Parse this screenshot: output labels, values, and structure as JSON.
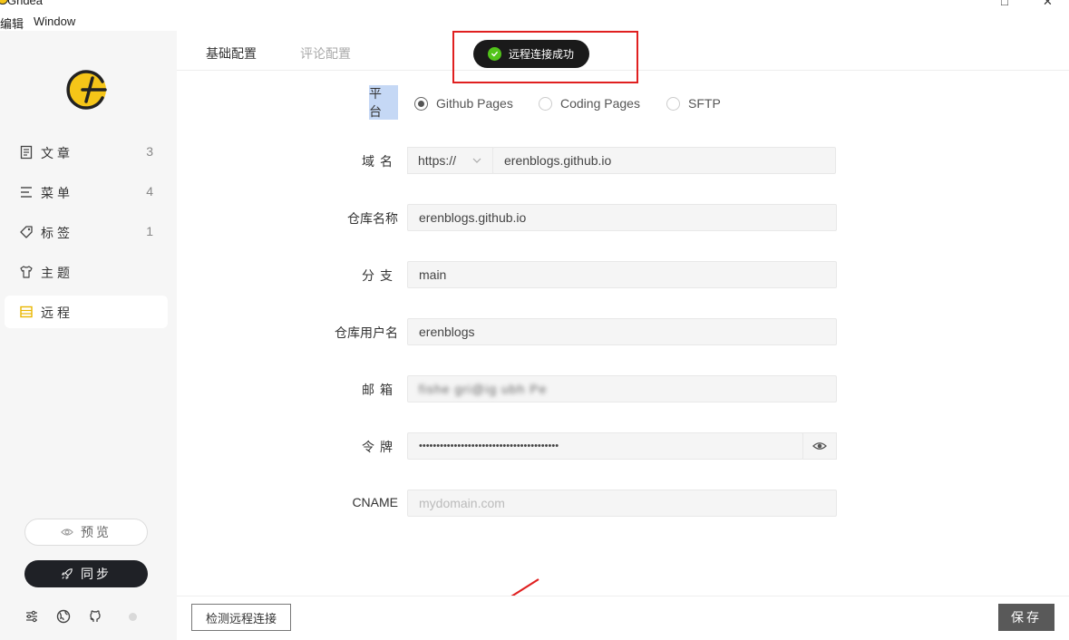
{
  "window": {
    "title": "Gridea",
    "menu": [
      "编辑",
      "Window"
    ],
    "controls": [
      "□",
      "✕"
    ]
  },
  "sidebar": {
    "logo": "gridea-logo",
    "items": [
      {
        "label": "文章",
        "count": "3",
        "icon": "article-icon",
        "active": false
      },
      {
        "label": "菜单",
        "count": "4",
        "icon": "menu-icon",
        "active": false
      },
      {
        "label": "标签",
        "count": "1",
        "icon": "tag-icon",
        "active": false
      },
      {
        "label": "主题",
        "count": "",
        "icon": "theme-icon",
        "active": false
      },
      {
        "label": "远程",
        "count": "",
        "icon": "remote-icon",
        "active": true
      }
    ],
    "preview_label": "预览",
    "sync_label": "同步",
    "footer_icons": [
      "settings-icon",
      "globe-icon",
      "github-icon"
    ]
  },
  "tabs": [
    {
      "label": "基础配置",
      "active": true
    },
    {
      "label": "评论配置",
      "active": false
    }
  ],
  "toast": {
    "text": "远程连接成功",
    "status_color": "#52c41a"
  },
  "form": {
    "platform_label": "平台",
    "platforms": [
      {
        "label": "Github Pages",
        "checked": true
      },
      {
        "label": "Coding Pages",
        "checked": false
      },
      {
        "label": "SFTP",
        "checked": false
      }
    ],
    "domain_label": "域名",
    "domain_protocol": "https://",
    "domain_value": "erenblogs.github.io",
    "repo_label": "仓库名称",
    "repo_value": "erenblogs.github.io",
    "branch_label": "分支",
    "branch_value": "main",
    "username_label": "仓库用户名",
    "username_value": "erenblogs",
    "email_label": "邮箱",
    "email_value": "fishe gri@ig ubh Pe",
    "token_label": "令牌",
    "token_value": "••••••••••••••••••••••••••••••••••••••••",
    "cname_label": "CNAME",
    "cname_placeholder": "mydomain.com"
  },
  "actions": {
    "check_label": "检测远程连接",
    "save_label": "保存"
  },
  "colors": {
    "accent": "#e9b600",
    "annotation": "#e02020",
    "sync_bg": "#1f2126",
    "save_bg": "#595959"
  }
}
